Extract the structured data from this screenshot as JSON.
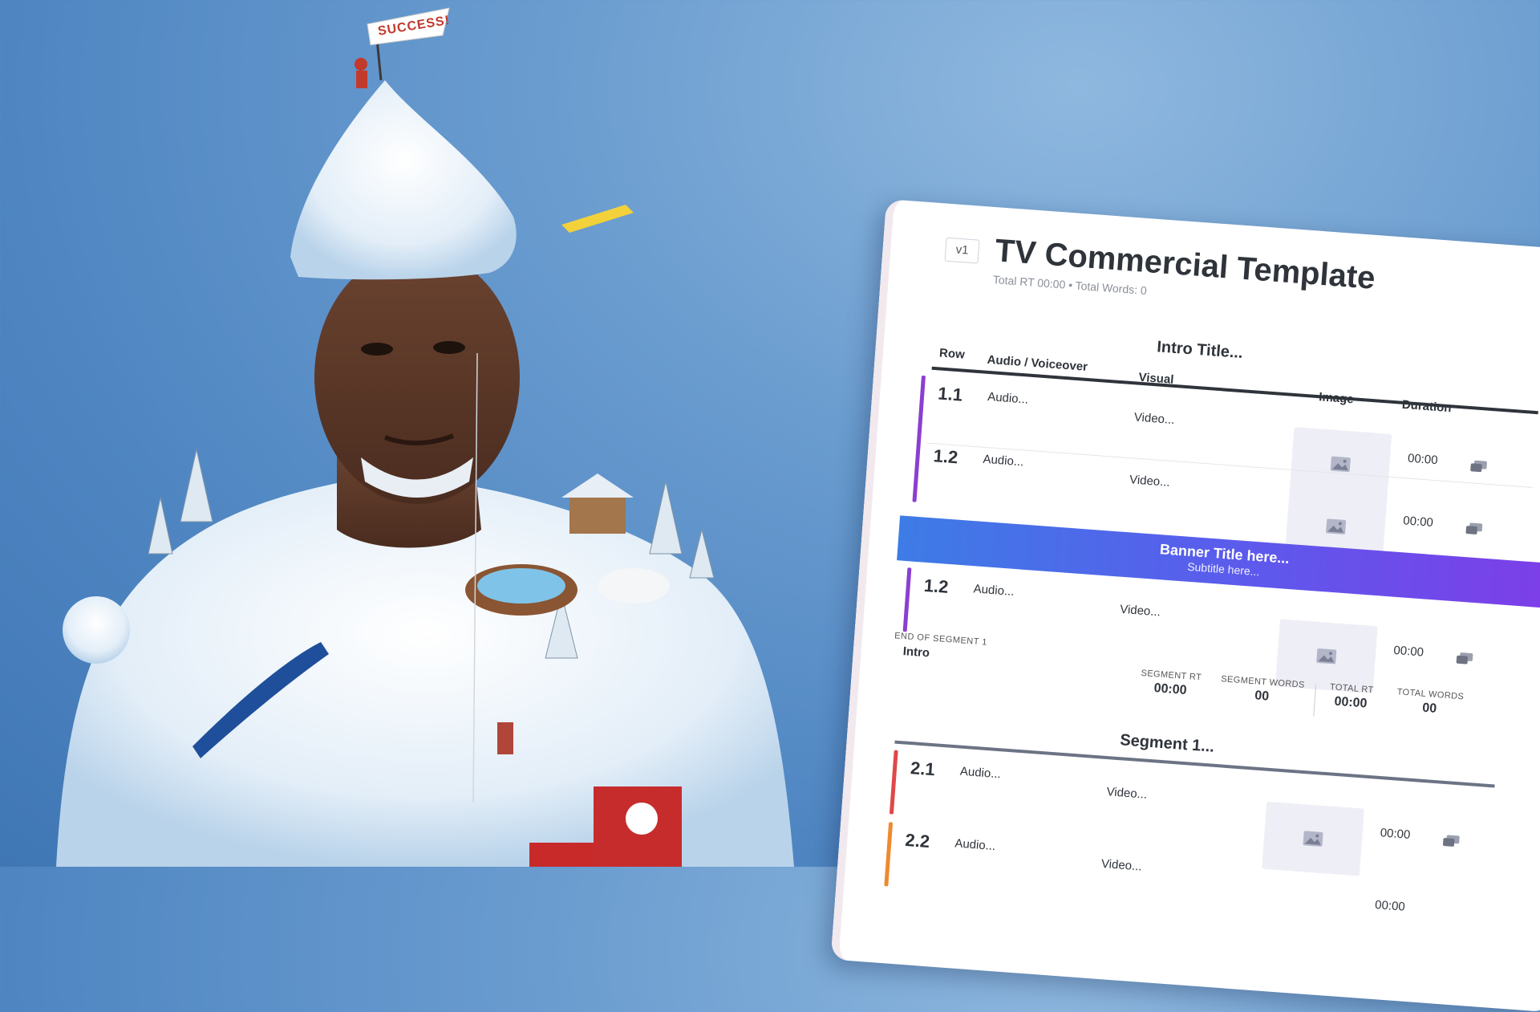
{
  "art": {
    "flag_text": "SUCCESS!"
  },
  "template": {
    "version": "v1",
    "title": "TV Commercial Template",
    "meta": "Total RT 00:00 • Total Words: 0",
    "intro_title": "Intro Title...",
    "columns": {
      "row": "Row",
      "audio": "Audio / Voiceover",
      "visual": "Visual",
      "image": "Image",
      "duration": "Duration"
    },
    "rows": [
      {
        "num": "1.1",
        "audio": "Audio...",
        "video": "Video...",
        "duration": "00:00",
        "color": "#8a3fd1"
      },
      {
        "num": "1.2",
        "audio": "Audio...",
        "video": "Video...",
        "duration": "00:00",
        "color": "#8a3fd1"
      },
      {
        "num": "1.2",
        "audio": "Audio...",
        "video": "Video...",
        "duration": "00:00",
        "color": "#8a3fd1"
      }
    ],
    "banner": {
      "title": "Banner Title here...",
      "subtitle": "Subtitle here..."
    },
    "end_segment": {
      "label": "END OF SEGMENT 1",
      "value": "Intro"
    },
    "stats": [
      {
        "label": "SEGMENT RT",
        "value": "00:00"
      },
      {
        "label": "SEGMENT WORDS",
        "value": "00"
      },
      {
        "label": "TOTAL RT",
        "value": "00:00"
      },
      {
        "label": "TOTAL WORDS",
        "value": "00"
      }
    ],
    "segment_title": "Segment 1...",
    "segment_rows": [
      {
        "num": "2.1",
        "audio": "Audio...",
        "video": "Video...",
        "duration": "00:00",
        "color": "#e04848"
      },
      {
        "num": "2.2",
        "audio": "Audio...",
        "video": "Video...",
        "duration": "00:00",
        "color": "#ee8a2e"
      }
    ]
  }
}
